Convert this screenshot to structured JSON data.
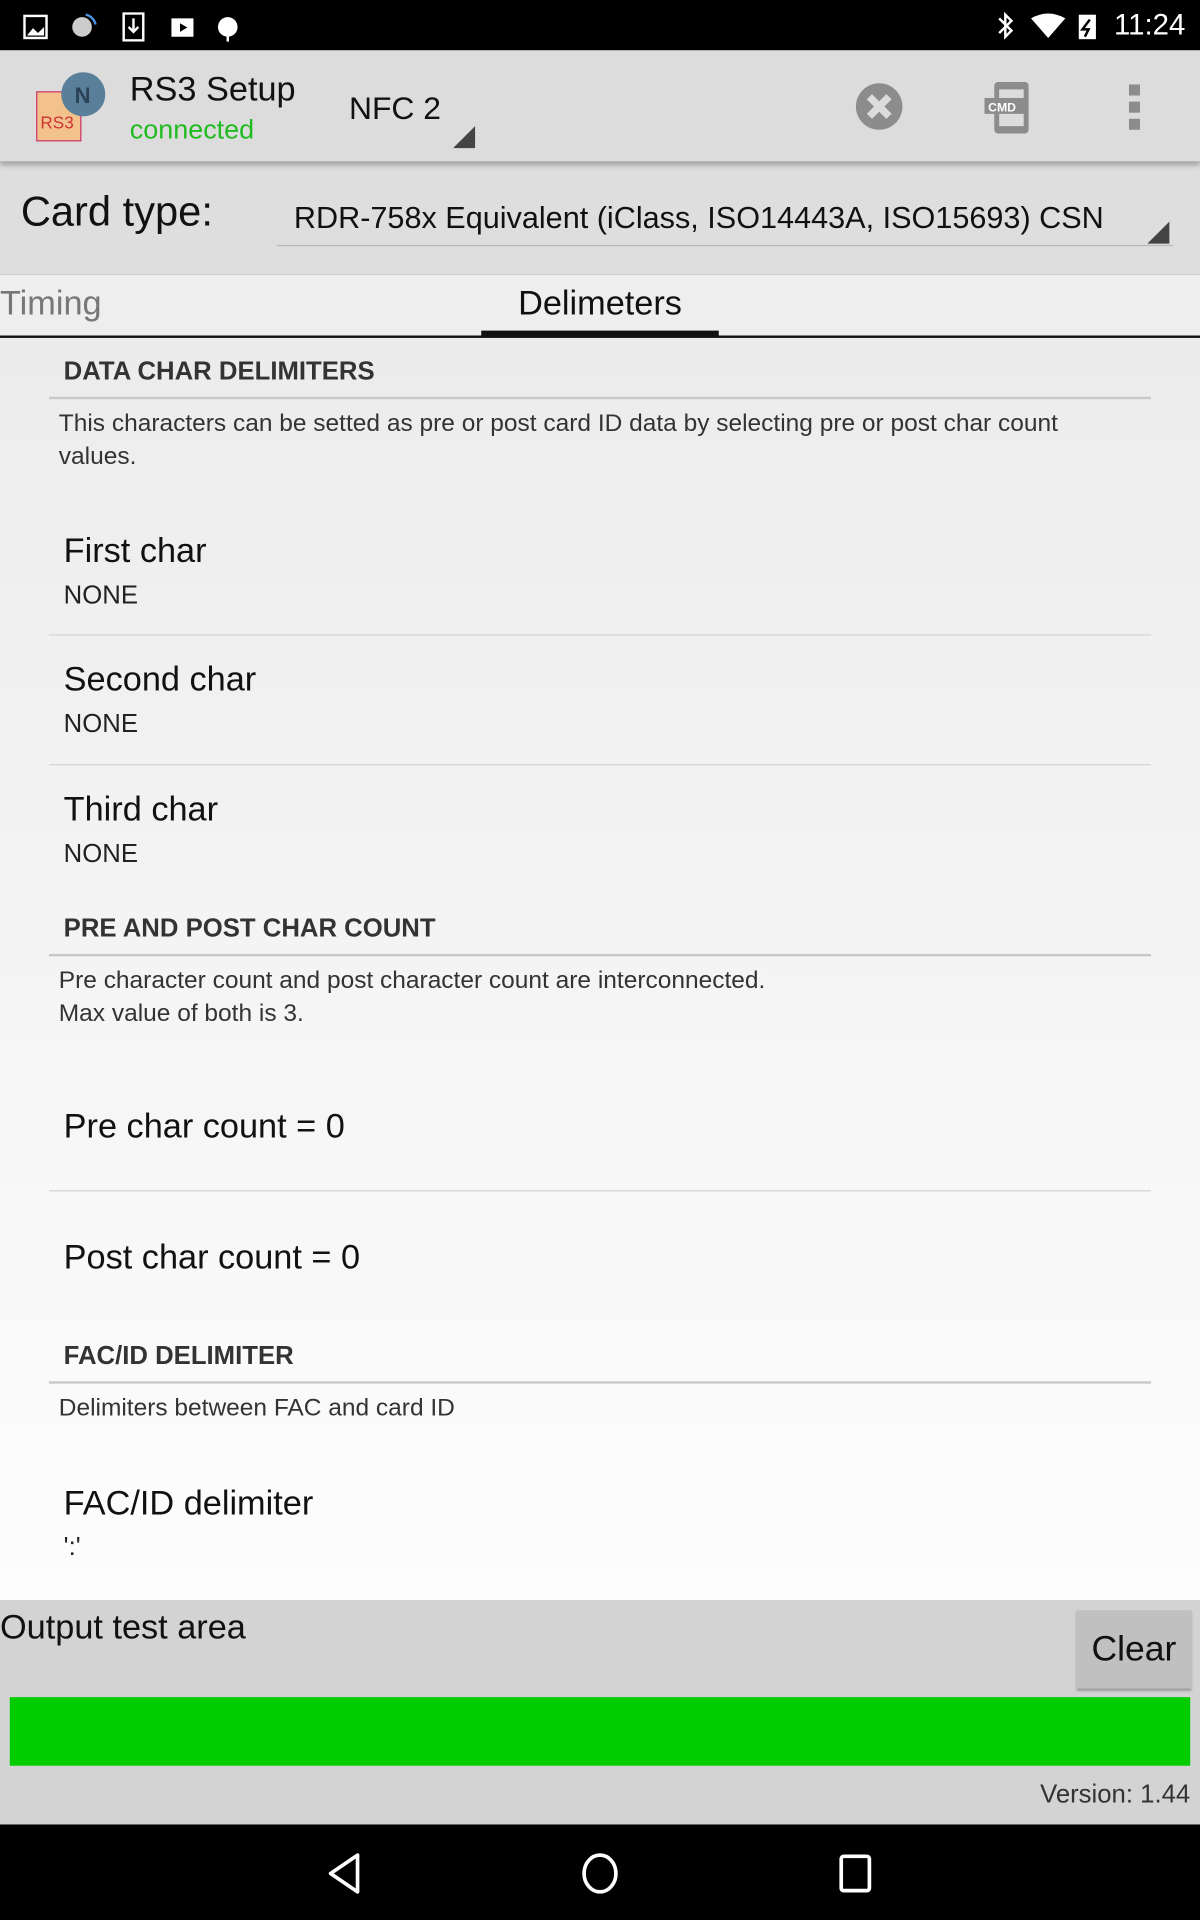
{
  "status_bar": {
    "time": "11:24",
    "left_icons": [
      "image-icon",
      "gear-signal-icon",
      "download-icon",
      "play-store-icon",
      "android-icon"
    ],
    "right_icons": [
      "bluetooth-icon",
      "wifi-icon",
      "battery-charging-icon"
    ]
  },
  "app_bar": {
    "title": "RS3 Setup",
    "subtitle": "connected",
    "subtitle_color": "#22bb22",
    "device": "NFC 2",
    "actions": [
      "close-circle-icon",
      "cmd-icon",
      "overflow-menu-icon"
    ]
  },
  "card_type": {
    "label": "Card type:",
    "value": "RDR-758x Equivalent (iClass, ISO14443A, ISO15693) CSN"
  },
  "tabs": [
    {
      "label": "Timing",
      "selected": false
    },
    {
      "label": "Delimeters",
      "selected": true
    }
  ],
  "sections": {
    "data_char": {
      "title": "DATA CHAR DELIMITERS",
      "description": "This characters can be setted as pre or post card ID data by selecting pre or post char count values.",
      "items": [
        {
          "title": "First char",
          "value": "NONE"
        },
        {
          "title": "Second char",
          "value": "NONE"
        },
        {
          "title": "Third char",
          "value": "NONE"
        }
      ]
    },
    "pre_post": {
      "title": "PRE AND POST CHAR COUNT",
      "description_1": "Pre character count and post character count are interconnected.",
      "description_2": "Max value of both is 3.",
      "items": [
        {
          "title": "Pre char count = 0"
        },
        {
          "title": "Post char count = 0"
        }
      ]
    },
    "fac_id": {
      "title": "FAC/ID DELIMITER",
      "description": "Delimiters between FAC and card ID",
      "items": [
        {
          "title": "FAC/ID delimiter",
          "value": "':'"
        }
      ]
    }
  },
  "output": {
    "label": "Output test area",
    "clear_label": "Clear",
    "indicator_color": "#00cc00",
    "version": "Version: 1.44"
  },
  "nav_bar": {
    "buttons": [
      "back-icon",
      "home-icon",
      "recents-icon"
    ]
  }
}
